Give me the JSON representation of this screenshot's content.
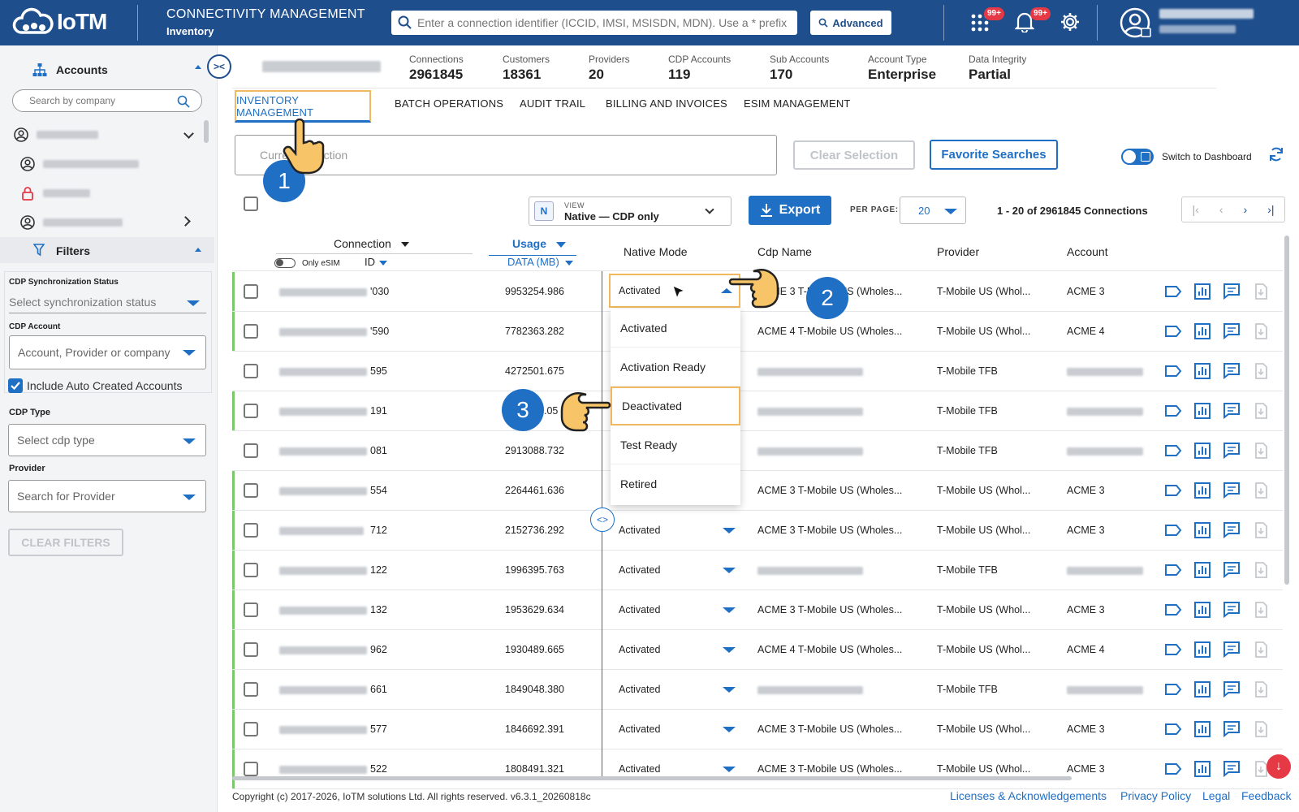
{
  "header": {
    "logo_text": "IoTM",
    "app_title": "CONNECTIVITY MANAGEMENT",
    "app_subtitle": "Inventory",
    "search_placeholder": "Enter a connection identifier (ICCID, IMSI, MSISDN, MDN). Use a * prefix",
    "advanced_label": "Advanced",
    "apps_badge": "99+",
    "notif_badge": "99+"
  },
  "sidebar": {
    "accounts_label": "Accounts",
    "company_search_placeholder": "Search by company",
    "filters_label": "Filters",
    "sync_label": "CDP Synchronization Status",
    "sync_placeholder": "Select synchronization status",
    "cdp_account_label": "CDP Account",
    "cdp_account_placeholder": "Account, Provider or company",
    "include_auto_label": "Include Auto Created Accounts",
    "cdp_type_label": "CDP Type",
    "cdp_type_placeholder": "Select cdp type",
    "provider_label": "Provider",
    "provider_placeholder": "Search for Provider",
    "clear_filters_label": "CLEAR FILTERS"
  },
  "stats": [
    {
      "label": "Connections",
      "value": "2961845"
    },
    {
      "label": "Customers",
      "value": "18361"
    },
    {
      "label": "Providers",
      "value": "20"
    },
    {
      "label": "CDP Accounts",
      "value": "119"
    },
    {
      "label": "Sub Accounts",
      "value": "170"
    },
    {
      "label": "Account Type",
      "value": "Enterprise"
    },
    {
      "label": "Data Integrity",
      "value": "Partial"
    }
  ],
  "tabs": [
    "INVENTORY MANAGEMENT",
    "BATCH OPERATIONS",
    "AUDIT TRAIL",
    "BILLING AND INVOICES",
    "ESIM MANAGEMENT"
  ],
  "toolbar": {
    "current_selection_placeholder": "Current Selection",
    "clear_selection_label": "Clear Selection",
    "favorite_searches_label": "Favorite Searches",
    "switch_dashboard_label": "Switch to Dashboard",
    "view_caption": "VIEW",
    "view_badge": "N",
    "view_value": "Native — CDP only",
    "export_label": "Export",
    "per_page_label": "PER PAGE:",
    "per_page_value": "20",
    "range_text": "1 - 20 of 2961845 Connections"
  },
  "table": {
    "col_connection": "Connection",
    "col_only_esim": "Only eSIM",
    "col_id": "ID",
    "col_usage": "Usage",
    "col_data": "DATA (MB)",
    "col_native_mode": "Native Mode",
    "col_cdp_name": "Cdp Name",
    "col_provider": "Provider",
    "col_account": "Account",
    "rows": [
      {
        "id": "'030",
        "usage": "9953254.986",
        "mode": "Activated",
        "cdp": "ACME 3 T-Mobile US (Wholes...",
        "provider": "T-Mobile US (Whol...",
        "account": "ACME 3"
      },
      {
        "id": "'590",
        "usage": "7782363.282",
        "mode": "",
        "cdp": "ACME 4 T-Mobile US (Wholes...",
        "provider": "T-Mobile US (Whol...",
        "account": "ACME 4"
      },
      {
        "id": "595",
        "usage": "4272501.675",
        "mode": "",
        "cdp": "",
        "provider": "T-Mobile TFB",
        "account": ""
      },
      {
        "id": "191",
        "usage": "",
        "mode": "",
        "cdp": "",
        "provider": "T-Mobile TFB",
        "account": ""
      },
      {
        "id": "081",
        "usage": "2913088.732",
        "mode": "",
        "cdp": "",
        "provider": "T-Mobile TFB",
        "account": ""
      },
      {
        "id": "554",
        "usage": "2264461.636",
        "mode": "",
        "cdp": "ACME 3 T-Mobile US (Wholes...",
        "provider": "T-Mobile US (Whol...",
        "account": "ACME 3"
      },
      {
        "id": "712",
        "usage": "2152736.292",
        "mode": "Activated",
        "cdp": "ACME 3 T-Mobile US (Wholes...",
        "provider": "T-Mobile US (Whol...",
        "account": "ACME 3"
      },
      {
        "id": "122",
        "usage": "1996395.763",
        "mode": "Activated",
        "cdp": "",
        "provider": "T-Mobile TFB",
        "account": ""
      },
      {
        "id": "132",
        "usage": "1953629.634",
        "mode": "Activated",
        "cdp": "ACME 3 T-Mobile US (Wholes...",
        "provider": "T-Mobile US (Whol...",
        "account": "ACME 3"
      },
      {
        "id": "962",
        "usage": "1930489.665",
        "mode": "Activated",
        "cdp": "ACME 4 T-Mobile US (Wholes...",
        "provider": "T-Mobile US (Whol...",
        "account": "ACME 4"
      },
      {
        "id": "661",
        "usage": "1849048.380",
        "mode": "Activated",
        "cdp": "",
        "provider": "T-Mobile TFB",
        "account": ""
      },
      {
        "id": "577",
        "usage": "1846692.391",
        "mode": "Activated",
        "cdp": "ACME 3 T-Mobile US (Wholes...",
        "provider": "T-Mobile US (Whol...",
        "account": "ACME 3"
      },
      {
        "id": "522",
        "usage": "1808491.321",
        "mode": "Activated",
        "cdp": "ACME 3 T-Mobile US (Wholes...",
        "provider": "T-Mobile US (Whol...",
        "account": "ACME 3"
      }
    ],
    "usage_partial": ".05"
  },
  "dropdown": {
    "current": "Activated",
    "options": [
      "Activated",
      "Activation Ready",
      "Deactivated",
      "Test Ready",
      "Retired"
    ]
  },
  "steps": [
    "1",
    "2",
    "3"
  ],
  "footer": {
    "copyright": "Copyright (c) 2017-2026, IoTM solutions Ltd. All rights reserved. v6.3.1_20260818c",
    "links": [
      "Licenses & Acknowledgements",
      "Privacy Policy",
      "Legal",
      "Feedback"
    ]
  },
  "colors": {
    "primary": "#1f4e8c",
    "accent": "#1f6fc4",
    "highlight": "#f0b961",
    "badge": "#e53945",
    "row_stripe": "#7bc86c"
  }
}
